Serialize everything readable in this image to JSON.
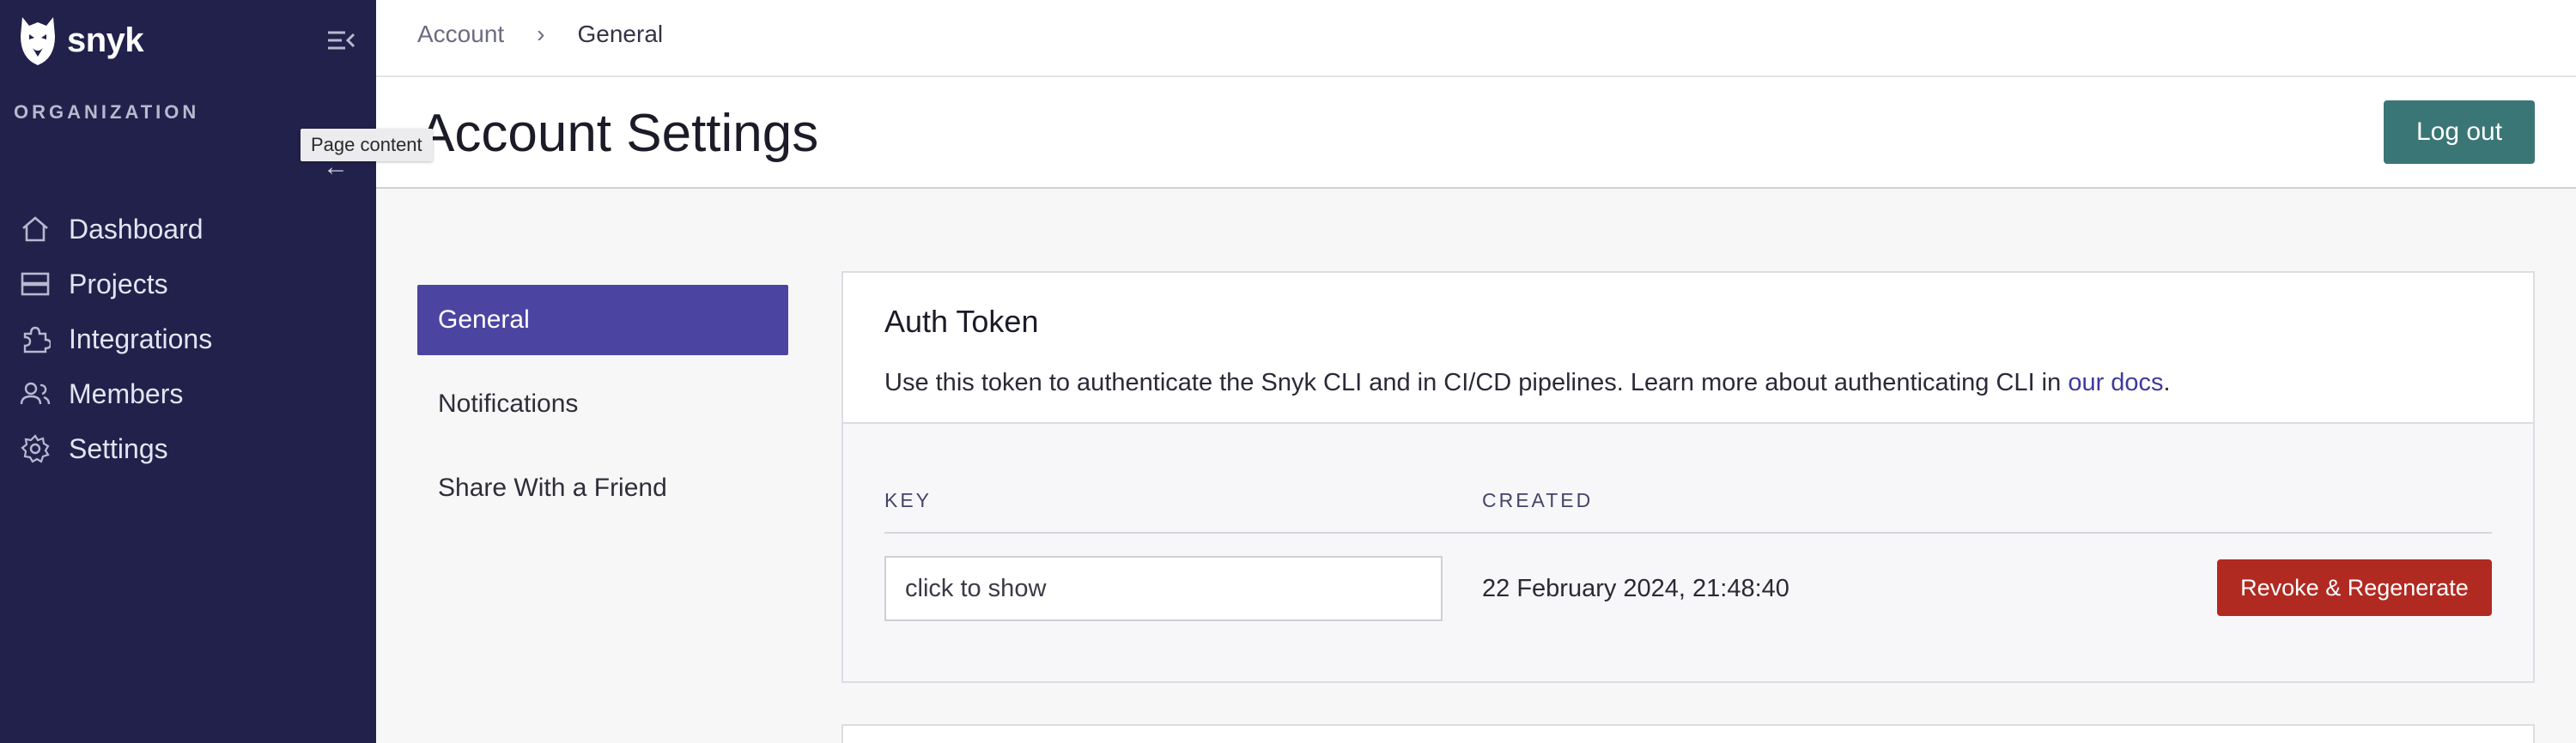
{
  "brand": {
    "name": "snyk"
  },
  "sidebar": {
    "section_label": "ORGANIZATION",
    "tooltip": "Page content",
    "items": [
      {
        "label": "Dashboard",
        "icon": "home-icon"
      },
      {
        "label": "Projects",
        "icon": "projects-icon"
      },
      {
        "label": "Integrations",
        "icon": "puzzle-icon"
      },
      {
        "label": "Members",
        "icon": "members-icon"
      },
      {
        "label": "Settings",
        "icon": "gear-icon"
      }
    ]
  },
  "breadcrumb": {
    "parent": "Account",
    "separator": "›",
    "current": "General"
  },
  "page": {
    "title": "Account Settings",
    "logout_label": "Log out"
  },
  "subnav": {
    "items": [
      {
        "label": "General",
        "active": true
      },
      {
        "label": "Notifications",
        "active": false
      },
      {
        "label": "Share With a Friend",
        "active": false
      }
    ]
  },
  "auth_token": {
    "title": "Auth Token",
    "description": "Use this token to authenticate the Snyk CLI and in CI/CD pipelines. Learn more about authenticating CLI in ",
    "docs_link": "our docs",
    "description_end": ".",
    "columns": {
      "key": "KEY",
      "created": "CREATED"
    },
    "key_value": "click to show",
    "created_value": "22 February 2024, 21:48:40",
    "revoke_label": "Revoke & Regenerate"
  },
  "colors": {
    "sidebar_bg": "#21214b",
    "active_nav": "#4b45a1",
    "logout": "#3b7676",
    "danger": "#b12a22",
    "link": "#3d3a9c"
  }
}
